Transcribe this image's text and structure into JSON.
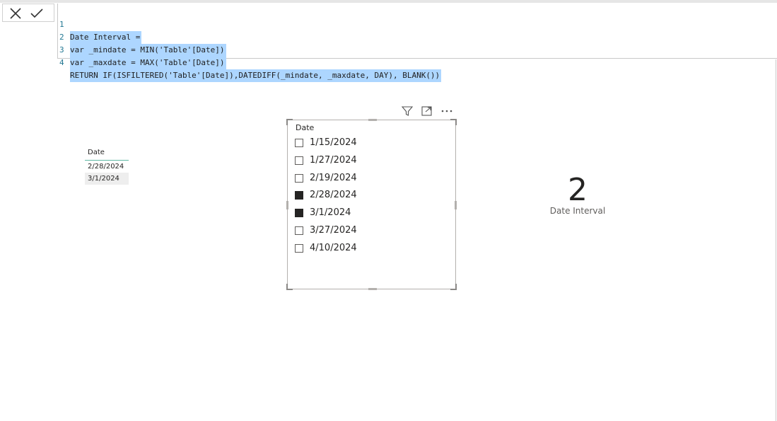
{
  "formula_bar": {
    "cancel_icon": "close-icon",
    "commit_icon": "checkmark-icon",
    "lines": [
      {
        "n": "1",
        "text": "Date Interval ="
      },
      {
        "n": "2",
        "text": "var _mindate = MIN('Table'[Date])"
      },
      {
        "n": "3",
        "text": "var _maxdate = MAX('Table'[Date])"
      },
      {
        "n": "4",
        "text": "RETURN IF(ISFILTERED('Table'[Date]),DATEDIFF(_mindate, _maxdate, DAY), BLANK())"
      }
    ]
  },
  "table_visual": {
    "header": "Date",
    "rows": [
      "2/28/2024",
      "3/1/2024"
    ]
  },
  "slicer": {
    "header_icons": [
      "filter-icon",
      "focus-mode-icon",
      "more-options-icon"
    ],
    "title": "Date",
    "items": [
      {
        "label": "1/15/2024",
        "checked": false
      },
      {
        "label": "1/27/2024",
        "checked": false
      },
      {
        "label": "2/19/2024",
        "checked": false
      },
      {
        "label": "2/28/2024",
        "checked": true
      },
      {
        "label": "3/1/2024",
        "checked": true
      },
      {
        "label": "3/27/2024",
        "checked": false
      },
      {
        "label": "4/10/2024",
        "checked": false
      }
    ]
  },
  "card": {
    "value": "2",
    "label": "Date Interval"
  },
  "colors": {
    "selection": "#add6ff",
    "keyword": "#0000ff",
    "checked": "#252423",
    "table_accent": "#5fb8a3"
  }
}
